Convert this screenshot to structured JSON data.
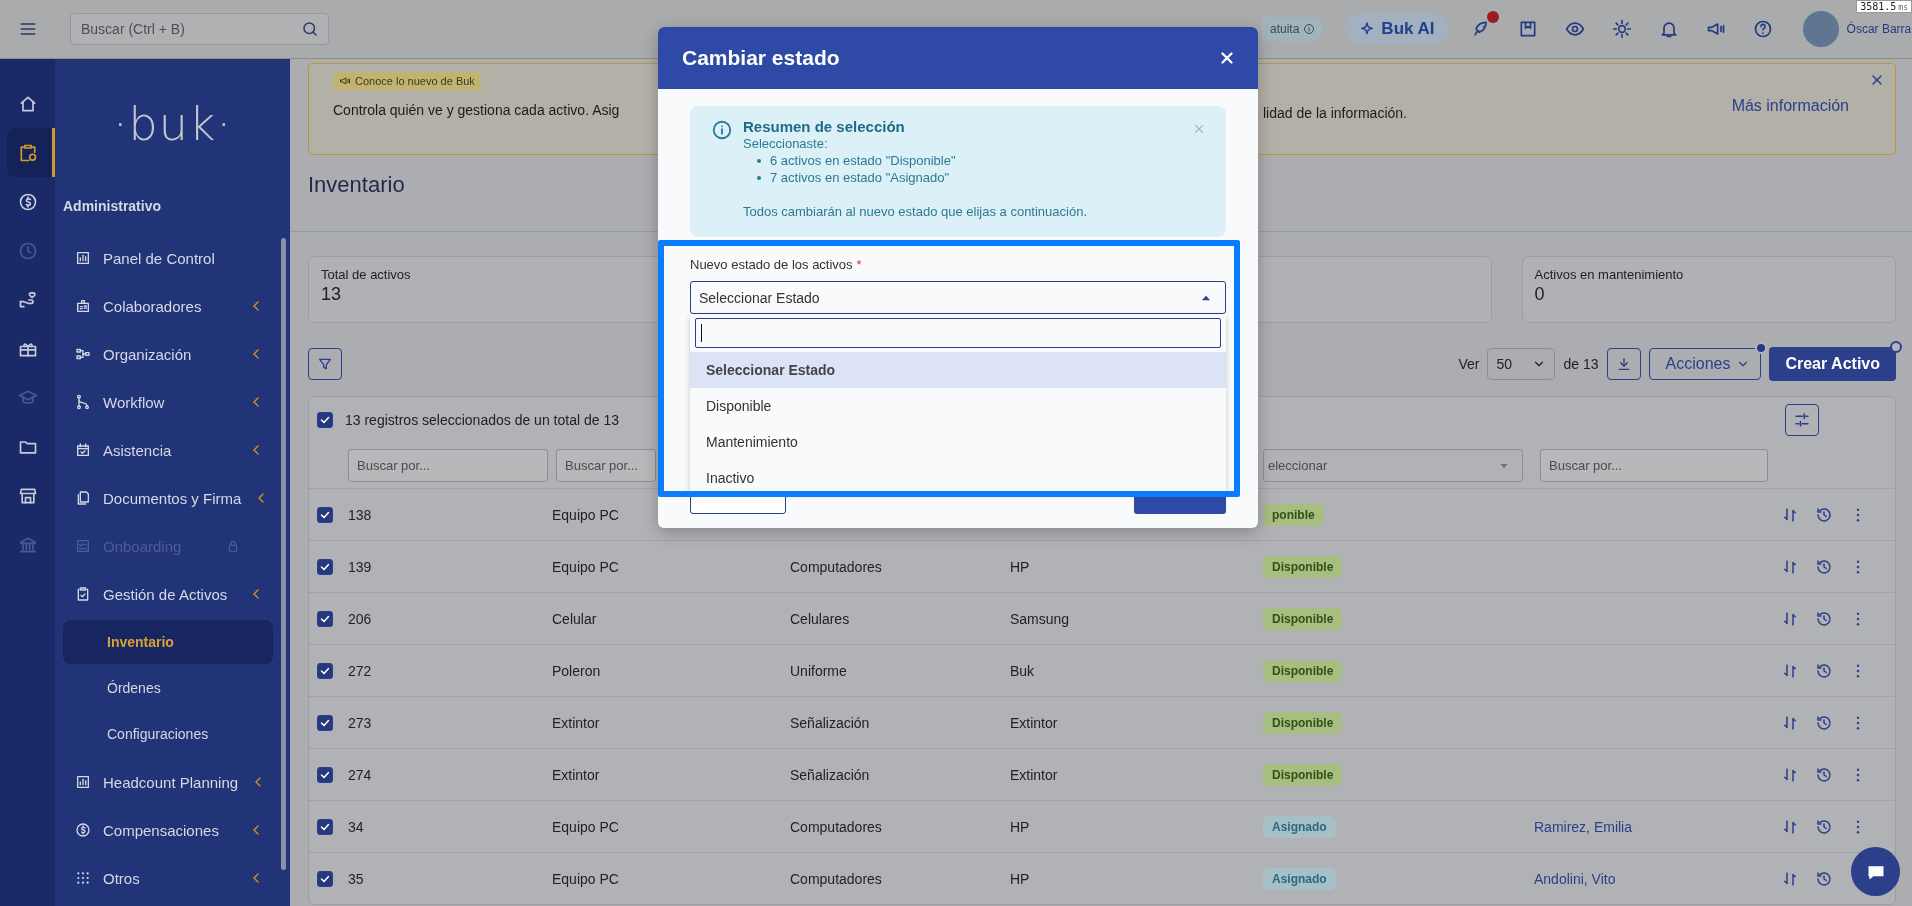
{
  "perf_badge": {
    "value": "3581.5",
    "unit": "ms"
  },
  "topbar": {
    "search": {
      "placeholder": "Buscar (Ctrl + B)"
    },
    "trial_badge": "atuita",
    "ai_button": "Buk AI",
    "rocket_alert": true,
    "user_name": "Óscar Barra"
  },
  "rail": [
    {
      "selected": false,
      "disabled": false
    },
    {
      "selected": true,
      "disabled": false
    },
    {
      "selected": false,
      "disabled": false
    },
    {
      "selected": false,
      "disabled": true
    },
    {
      "selected": false,
      "disabled": false
    },
    {
      "selected": false,
      "disabled": false
    },
    {
      "selected": false,
      "disabled": true
    },
    {
      "selected": false,
      "disabled": false
    },
    {
      "selected": false,
      "disabled": false
    },
    {
      "selected": false,
      "disabled": true
    }
  ],
  "sidebar": {
    "logo": "·buk·",
    "section": "Administrativo",
    "items": [
      {
        "label": "Panel de Control",
        "chevron": false,
        "disabled": false,
        "locked": false
      },
      {
        "label": "Colaboradores",
        "chevron": true,
        "disabled": false,
        "locked": false
      },
      {
        "label": "Organización",
        "chevron": true,
        "disabled": false,
        "locked": false
      },
      {
        "label": "Workflow",
        "chevron": true,
        "disabled": false,
        "locked": false
      },
      {
        "label": "Asistencia",
        "chevron": true,
        "disabled": false,
        "locked": false
      },
      {
        "label": "Documentos y Firma",
        "chevron": true,
        "disabled": false,
        "locked": false
      },
      {
        "label": "Onboarding",
        "chevron": false,
        "disabled": true,
        "locked": true
      },
      {
        "label": "Gestión de Activos",
        "chevron": true,
        "disabled": false,
        "locked": false,
        "children": [
          {
            "label": "Inventario",
            "selected": true
          },
          {
            "label": "Órdenes",
            "selected": false
          },
          {
            "label": "Configuraciones",
            "selected": false
          }
        ]
      },
      {
        "label": "Headcount Planning",
        "chevron": true,
        "disabled": false,
        "locked": false
      },
      {
        "label": "Compensaciones",
        "chevron": true,
        "disabled": false,
        "locked": false
      },
      {
        "label": "Otros",
        "chevron": true,
        "disabled": false,
        "locked": false
      }
    ]
  },
  "banner": {
    "tag": "Conoce lo nuevo de Buk",
    "text_start": "Controla quién ve y gestiona cada activo. Asig",
    "text_end": "lidad de la información.",
    "link": "Más información"
  },
  "page_title": "Inventario",
  "stats": [
    {
      "label": "Total de activos",
      "value": "13"
    },
    {
      "label": "Activos en mantenimiento",
      "value": "0"
    }
  ],
  "toolbar": {
    "show_label": "Ver",
    "page_size": "50",
    "of_total": "de 13",
    "actions": "Acciones",
    "actions_dot": true,
    "create": "Crear Activo"
  },
  "table": {
    "all_checked": true,
    "selection_text": "13 registros seleccionados de un total de 13",
    "filters": [
      {
        "kind": "input",
        "placeholder": "Buscar por..."
      },
      {
        "kind": "input",
        "placeholder": "Buscar por..."
      },
      {
        "kind": "select",
        "placeholder": "eleccionar"
      },
      {
        "kind": "input",
        "placeholder": "Buscar por..."
      }
    ],
    "rows": [
      {
        "checked": true,
        "id": "138",
        "type": "Equipo PC",
        "status": {
          "text": "ponible",
          "kind": "available"
        }
      },
      {
        "checked": true,
        "id": "139",
        "type": "Equipo PC",
        "category": "Computadores",
        "brand": "HP",
        "status": {
          "text": "Disponible",
          "kind": "available"
        }
      },
      {
        "checked": true,
        "id": "206",
        "type": "Celular",
        "category": "Celulares",
        "brand": "Samsung",
        "status": {
          "text": "Disponible",
          "kind": "available"
        }
      },
      {
        "checked": true,
        "id": "272",
        "type": "Poleron",
        "category": "Uniforme",
        "brand": "Buk",
        "status": {
          "text": "Disponible",
          "kind": "available"
        }
      },
      {
        "checked": true,
        "id": "273",
        "type": "Extintor",
        "category": "Señalización",
        "brand": "Extintor",
        "status": {
          "text": "Disponible",
          "kind": "available"
        }
      },
      {
        "checked": true,
        "id": "274",
        "type": "Extintor",
        "category": "Señalización",
        "brand": "Extintor",
        "status": {
          "text": "Disponible",
          "kind": "available"
        }
      },
      {
        "checked": true,
        "id": "34",
        "type": "Equipo PC",
        "category": "Computadores",
        "brand": "HP",
        "status": {
          "text": "Asignado",
          "kind": "assigned"
        },
        "assignee": "Ramirez, Emilia"
      },
      {
        "checked": true,
        "id": "35",
        "type": "Equipo PC",
        "category": "Computadores",
        "brand": "HP",
        "status": {
          "text": "Asignado",
          "kind": "assigned"
        },
        "assignee": "Andolini, Vito"
      }
    ]
  },
  "modal": {
    "title": "Cambiar estado",
    "alert": {
      "title": "Resumen de selección",
      "intro": "Seleccionaste:",
      "bullets": [
        "6 activos en estado \"Disponible\"",
        "7 activos en estado \"Asignado\""
      ],
      "footer": "Todos cambiarán al nuevo estado que elijas a continuación."
    },
    "field": {
      "label": "Nuevo estado de los activos",
      "required_mark": "*",
      "value": "Seleccionar Estado",
      "expanded": true,
      "options": [
        {
          "label": "Seleccionar Estado",
          "selected": true
        },
        {
          "label": "Disponible",
          "selected": false
        },
        {
          "label": "Mantenimiento",
          "selected": false
        },
        {
          "label": "Inactivo",
          "selected": false
        }
      ]
    }
  }
}
